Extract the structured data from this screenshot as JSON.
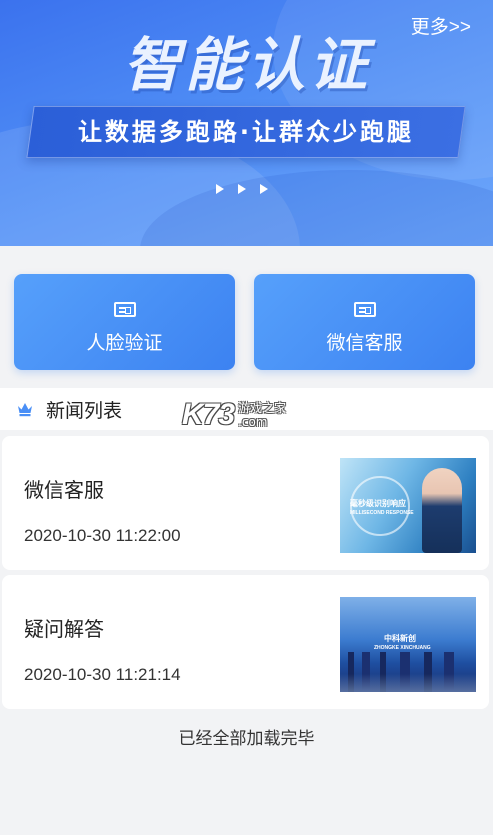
{
  "banner": {
    "title": "智能认证",
    "more_link": "更多>>",
    "slogan": "让数据多跑路·让群众少跑腿"
  },
  "actions": [
    {
      "label": "人脸验证",
      "icon": "id-card-icon"
    },
    {
      "label": "微信客服",
      "icon": "id-card-icon"
    }
  ],
  "news": {
    "header": "新闻列表",
    "items": [
      {
        "title": "微信客服",
        "time": "2020-10-30 11:22:00",
        "thumb_text_1": "毫秒级识别响应",
        "thumb_text_2": "MILLISECOND RESPONSE"
      },
      {
        "title": "疑问解答",
        "time": "2020-10-30 11:21:14",
        "thumb_text_1": "中科新创",
        "thumb_text_2": "ZHONGKE XINCHUANG"
      }
    ],
    "footer": "已经全部加载完毕"
  },
  "watermark": {
    "main": "K73",
    "sub1": "游戏之家",
    "sub2": ".com"
  },
  "colors": {
    "banner_blue": "#3b72ee",
    "card_blue": "#4a8ff6",
    "background": "#f2f3f5"
  }
}
